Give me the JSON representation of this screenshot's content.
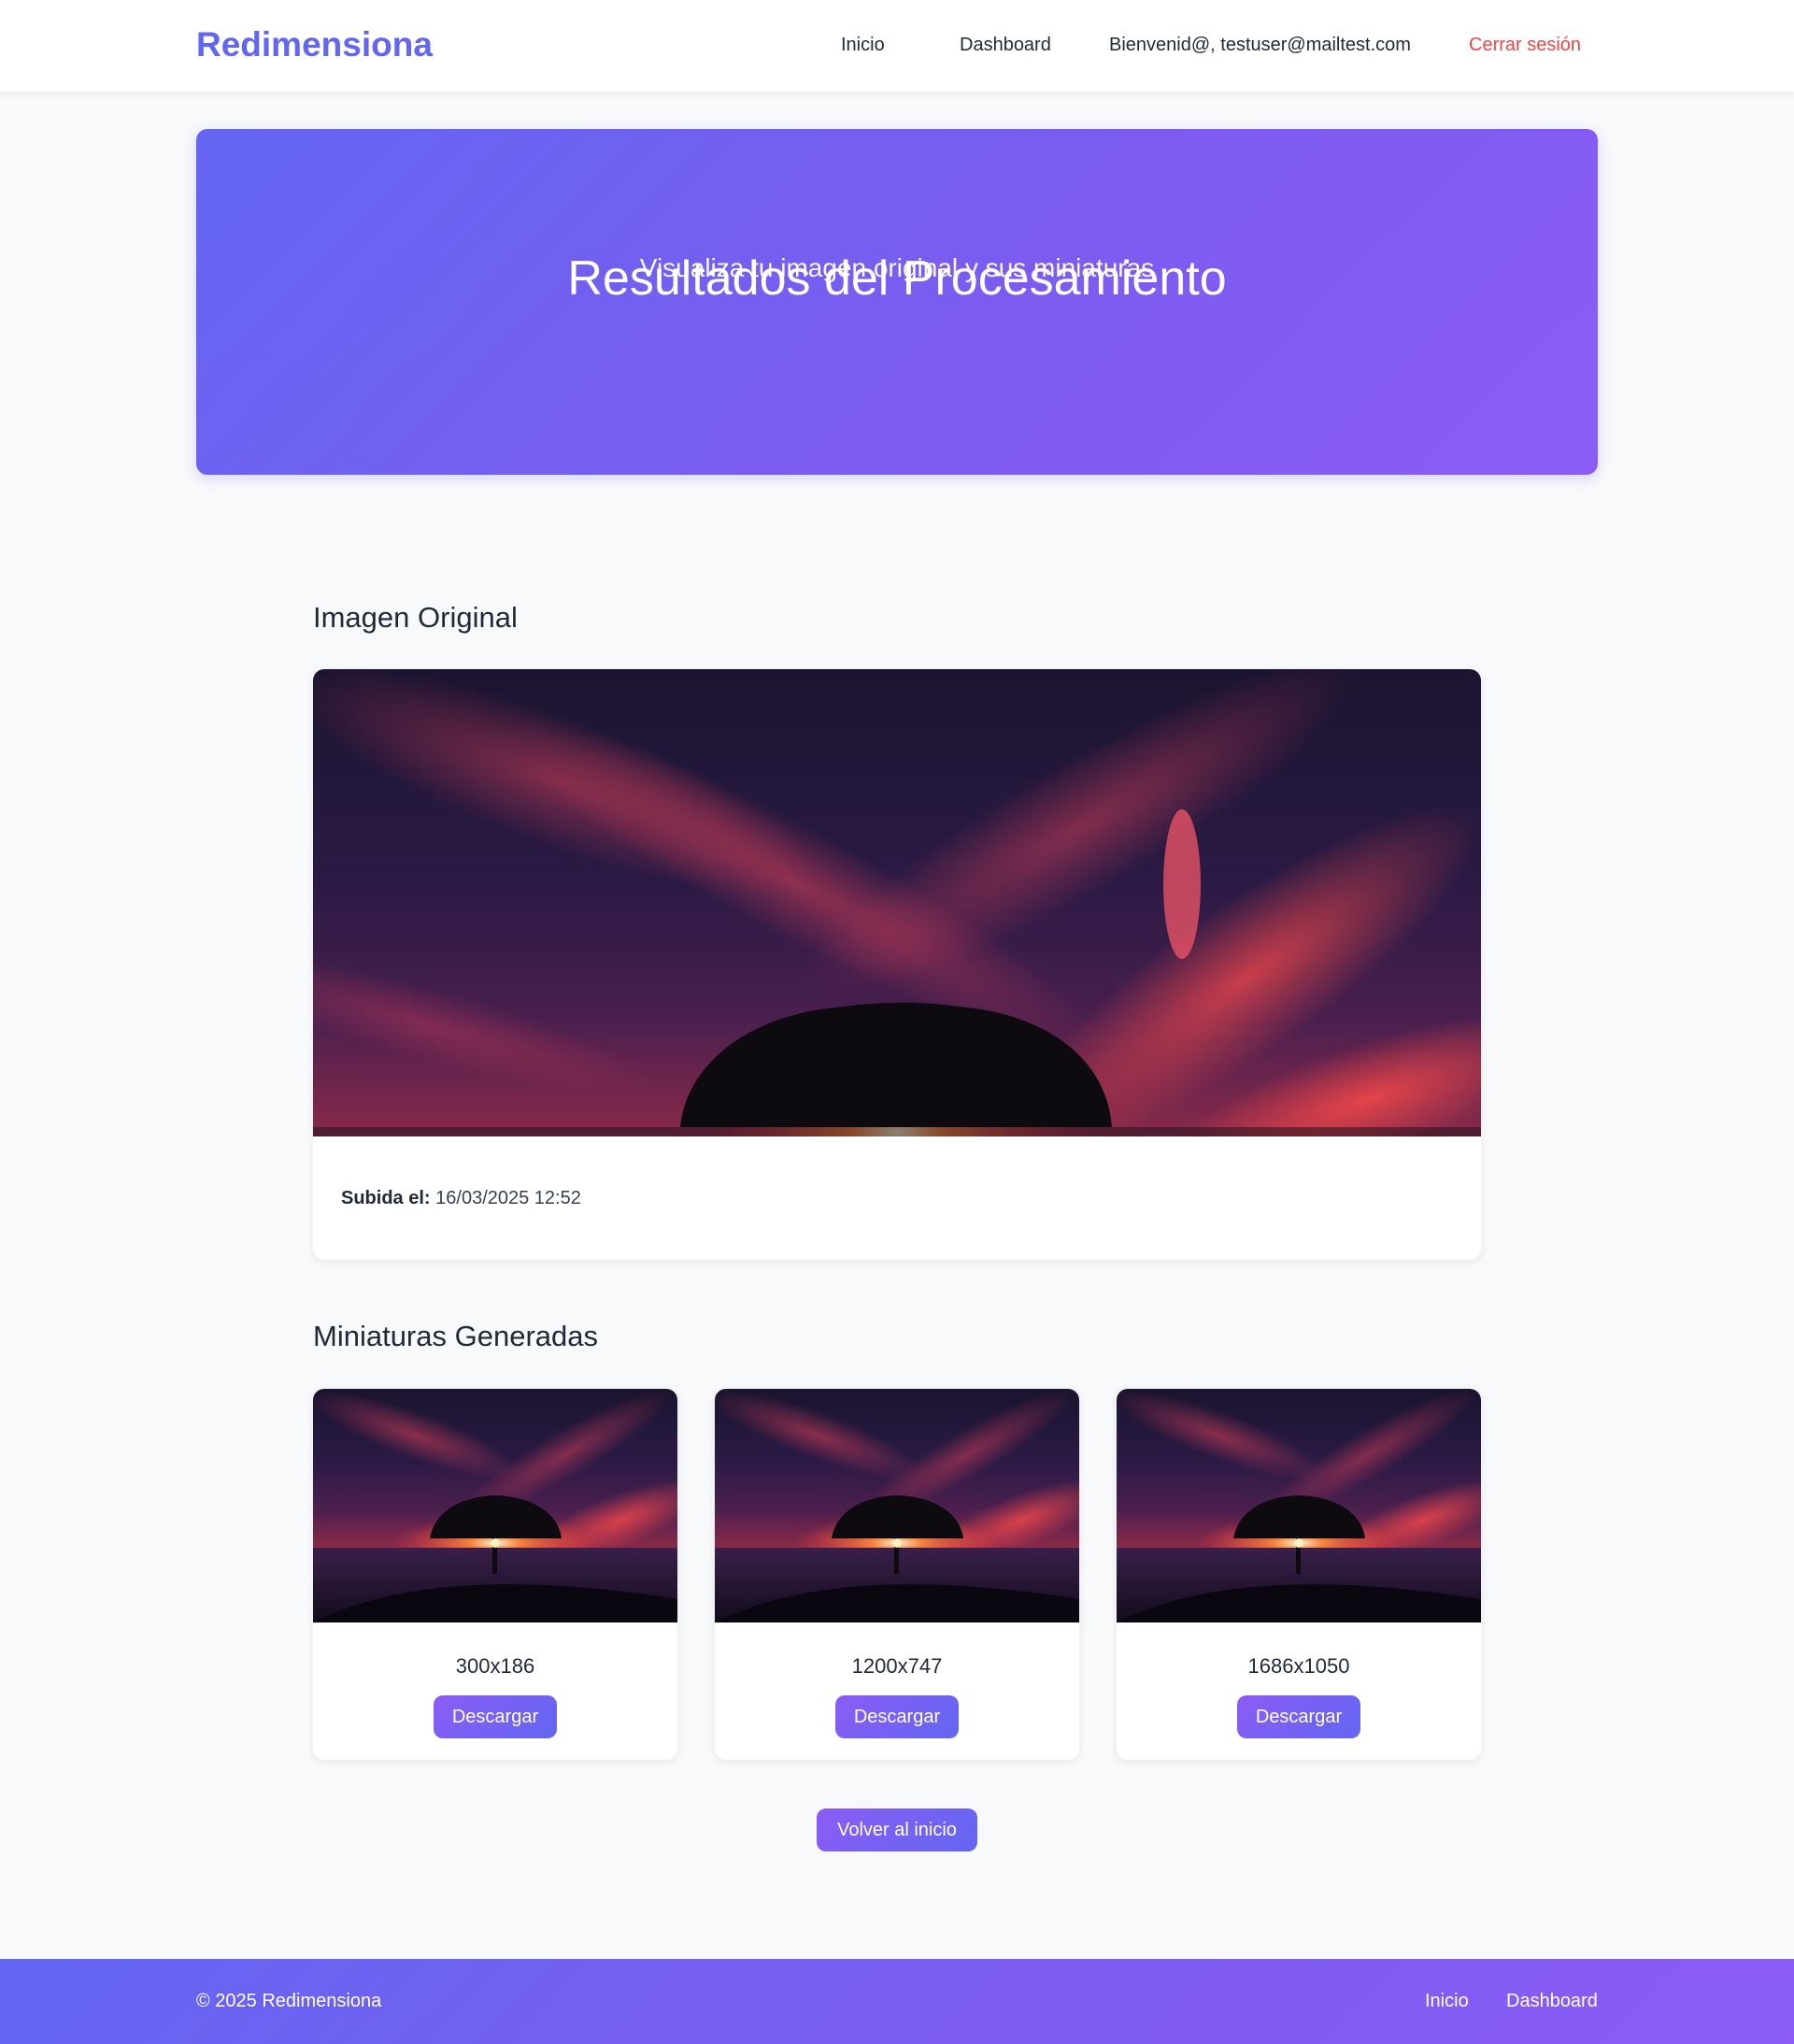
{
  "navbar": {
    "brand": "Redimensiona",
    "links": [
      {
        "label": "Inicio"
      },
      {
        "label": "Dashboard"
      }
    ],
    "welcome": "Bienvenid@, testuser@mailtest.com",
    "logout": "Cerrar sesión",
    "logout_color": "#ef4444",
    "brand_color": "#6366f1"
  },
  "hero": {
    "title": "Resultados del Procesamiento",
    "subtitle": "Visualiza tu imagen original y sus miniaturas",
    "gradient": [
      "#6366f1",
      "#8b5cf6"
    ]
  },
  "original": {
    "heading": "Imagen Original",
    "uploaded_label": "Subida el:",
    "uploaded_value": "16/03/2025 12:52"
  },
  "thumbnails": {
    "heading": "Miniaturas Generadas",
    "items": [
      {
        "size": "300x186",
        "button": "Descargar"
      },
      {
        "size": "1200x747",
        "button": "Descargar"
      },
      {
        "size": "1686x1050",
        "button": "Descargar"
      }
    ]
  },
  "back_button": "Volver al inicio",
  "footer": {
    "copyright": "© 2025 Redimensiona",
    "links": [
      {
        "label": "Inicio"
      },
      {
        "label": "Dashboard"
      }
    ]
  }
}
